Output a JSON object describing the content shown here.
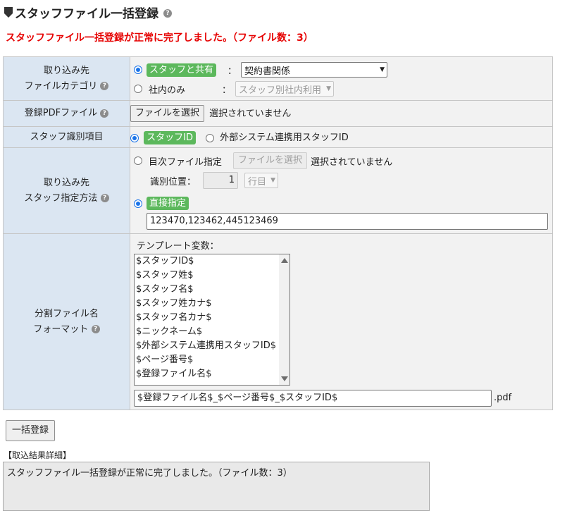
{
  "header": {
    "title": "スタッフファイル一括登録",
    "success_message": "スタッフファイル一括登録が正常に完了しました。（ファイル数：3）"
  },
  "category": {
    "label_line1": "取り込み先",
    "label_line2": "ファイルカテゴリ",
    "opt_shared_label": "スタッフと共有",
    "opt_shared_value": "契約書関係",
    "opt_internal_label": "社内のみ",
    "opt_internal_value": "スタッフ別社内利用",
    "colon": "："
  },
  "pdf_file": {
    "label": "登録PDFファイル",
    "button": "ファイルを選択",
    "status": "選択されていません"
  },
  "staff_identifier": {
    "label": "スタッフ識別項目",
    "opt_staff_id": "スタッフID",
    "opt_external_id": "外部システム連携用スタッフID"
  },
  "staff_method": {
    "label_line1": "取り込み先",
    "label_line2": "スタッフ指定方法",
    "opt_toc_file": "目次ファイル指定",
    "toc_button": "ファイルを選択",
    "toc_status": "選択されていません",
    "position_label": "識別位置：",
    "position_value": "1",
    "position_unit": "行目",
    "opt_direct": "直接指定",
    "direct_value": "123470,123462,445123469"
  },
  "filename_format": {
    "label_line1": "分割ファイル名",
    "label_line2": "フォーマット",
    "template_vars_label": "テンプレート変数：",
    "template_vars": [
      "$スタッフID$",
      "$スタッフ姓$",
      "$スタッフ名$",
      "$スタッフ姓カナ$",
      "$スタッフ名カナ$",
      "$ニックネーム$",
      "$外部システム連携用スタッフID$",
      "$ページ番号$",
      "$登録ファイル名$"
    ],
    "format_value": "$登録ファイル名$_$ページ番号$_$スタッフID$",
    "extension": ".pdf"
  },
  "actions": {
    "submit_label": "一括登録"
  },
  "result": {
    "label": "【取込結果詳細】",
    "text": "スタッフファイル一括登録が正常に完了しました。（ファイル数：3）"
  },
  "icons": {
    "help": "?"
  },
  "colors": {
    "error_red": "#e60000",
    "label_bg": "#dbe6f2",
    "badge_green": "#5cb85c",
    "radio_blue": "#1a73e8"
  }
}
